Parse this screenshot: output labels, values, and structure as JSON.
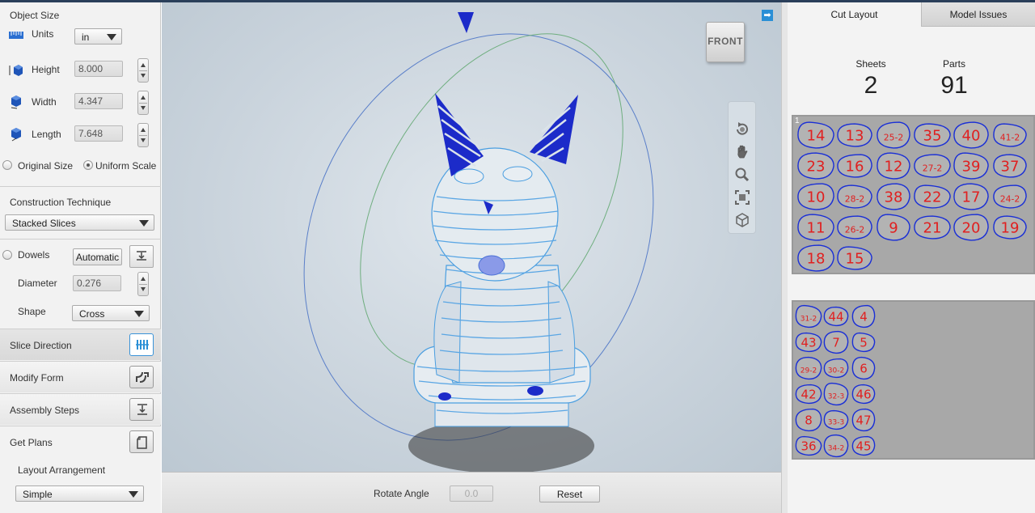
{
  "object_size": {
    "title": "Object Size",
    "units_label": "Units",
    "units_value": "in",
    "height_label": "Height",
    "height_value": "8.000",
    "width_label": "Width",
    "width_value": "4.347",
    "length_label": "Length",
    "length_value": "7.648",
    "original_size_label": "Original Size",
    "uniform_scale_label": "Uniform Scale"
  },
  "construction": {
    "title": "Construction Technique",
    "value": "Stacked Slices"
  },
  "dowels": {
    "label": "Dowels",
    "mode": "Automatic",
    "diameter_label": "Diameter",
    "diameter_value": "0.276",
    "shape_label": "Shape",
    "shape_value": "Cross"
  },
  "sections": {
    "slice_direction": "Slice Direction",
    "modify_form": "Modify Form",
    "assembly_steps": "Assembly Steps",
    "get_plans": "Get Plans"
  },
  "layout": {
    "label": "Layout Arrangement",
    "value": "Simple"
  },
  "viewport": {
    "view_cube_label": "FRONT",
    "expand_glyph": "➡"
  },
  "bottom_bar": {
    "rotate_label": "Rotate Angle",
    "rotate_value": "0.0",
    "reset_label": "Reset"
  },
  "right_panel": {
    "tabs": [
      "Cut Layout",
      "Model Issues"
    ],
    "sheets_label": "Sheets",
    "sheets_value": "2",
    "parts_label": "Parts",
    "parts_value": "91",
    "sheet1_corner": "1",
    "sheet1_parts": [
      "14",
      "13",
      "25-2",
      "35",
      "40",
      "41-2",
      "23",
      "16",
      "12",
      "27-2",
      "39",
      "37",
      "10",
      "28-2",
      "38",
      "22",
      "17",
      "24-2",
      "11",
      "26-2",
      "9",
      "21",
      "20",
      "19",
      "18",
      "15"
    ],
    "sheet2_parts": [
      "31-2",
      "44",
      "4",
      "43",
      "7",
      "5",
      "29-2",
      "30-2",
      "6",
      "42",
      "32-3",
      "46",
      "8",
      "33-3",
      "47",
      "36",
      "34-2",
      "45"
    ]
  },
  "colors": {
    "accent": "#2a8fd6",
    "part_outline": "#1a2fd6",
    "part_label": "#e02020",
    "sheet_bg": "#a8a8a8",
    "model_blue": "#1c2bc9"
  }
}
